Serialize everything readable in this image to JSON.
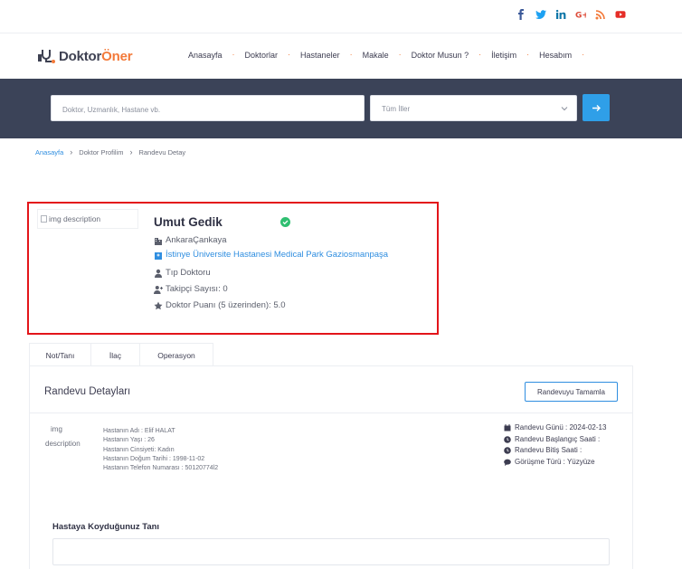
{
  "social": [
    "facebook-icon",
    "twitter-icon",
    "linkedin-icon",
    "google-plus-icon",
    "rss-icon",
    "youtube-icon"
  ],
  "colors": {
    "brand_orange": "#f37a3a",
    "brand_dark": "#3e4152",
    "search_band": "#3b4358",
    "accent_blue": "#2f9fe8",
    "highlight_red": "#e3151a",
    "verified_green": "#2fbf71"
  },
  "logo": {
    "part1": "Doktor",
    "part2": "Öner"
  },
  "nav": [
    "Anasayfa",
    "Doktorlar",
    "Hastaneler",
    "Makale",
    "Doktor Musun ?",
    "İletişim",
    "Hesabım"
  ],
  "search": {
    "placeholder": "Doktor, Uzmanlık, Hastane vb.",
    "city_selected": "Tüm İller"
  },
  "breadcrumb": [
    "Anasayfa",
    "Doktor Profilim",
    "Randevu Detay"
  ],
  "doctor": {
    "image_alt": "img description",
    "name": "Umut Gedik",
    "location": "AnkaraÇankaya",
    "hospital": "İstinye Üniversite Hastanesi Medical Park Gaziosmanpaşa",
    "specialty": "Tıp Doktoru",
    "followers": "Takipçi Sayısı: 0",
    "rating": "Doktor Puanı (5 üzerinden): 5.0"
  },
  "tabs": [
    "Not/Tanı",
    "İlaç",
    "Operasyon"
  ],
  "panel": {
    "title": "Randevu Detayları",
    "complete_button": "Randevuyu Tamamla",
    "patient_image_alt_1": "img",
    "patient_image_alt_2": "description",
    "patient": [
      "Hastanın Adı : Elif HALAT",
      "Hastanın Yaşı : 26",
      "Hastanın Cinsiyeti: Kadın",
      "Hastanın Doğum Tarihi : 1998-11-02",
      "Hastanın Telefon Numarası : 50120774l2"
    ],
    "appointment": [
      "Randevu Günü : 2024-02-13",
      "Randevu Başlangıç Saati :",
      "Randevu Bitiş Saati :",
      "Görüşme Türü : Yüzyüze"
    ],
    "diagnosis_label": "Hastaya Koyduğunuz Tanı"
  }
}
